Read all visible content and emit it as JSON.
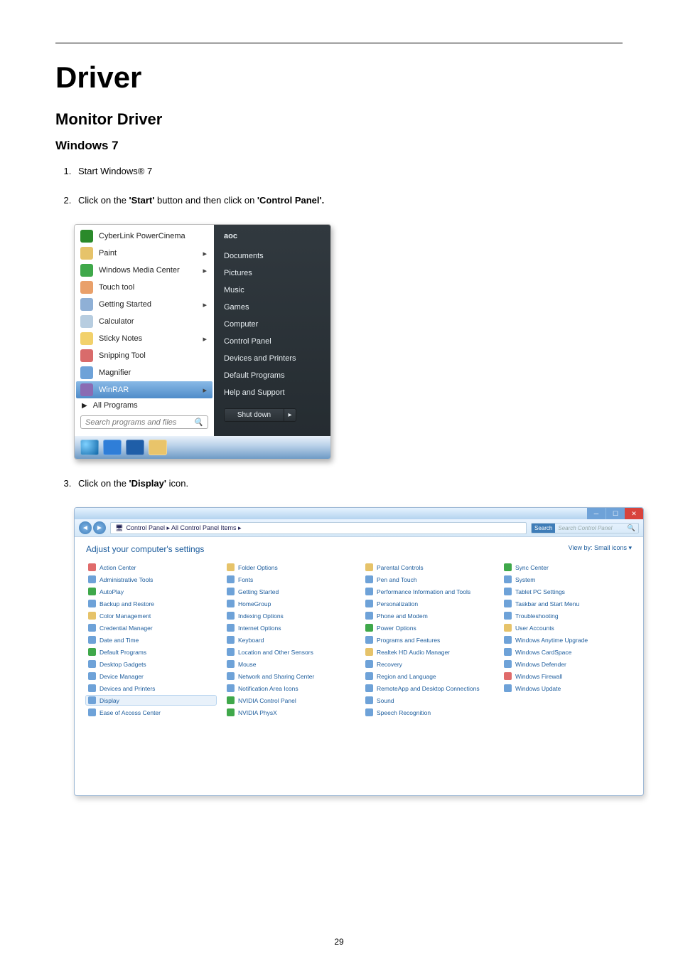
{
  "page_number": "29",
  "title": "Driver",
  "section": "Monitor Driver",
  "subsection": "Windows 7",
  "steps": [
    {
      "n": "1.",
      "plain": "Start Windows® 7"
    },
    {
      "n": "2.",
      "pre": "Click on the ",
      "b1": "'Start'",
      "mid": " button and then click on ",
      "b2": "'Control Panel'."
    },
    {
      "n": "3.",
      "pre": "Click on the ",
      "b1": "'Display'",
      "post": " icon."
    }
  ],
  "start_menu": {
    "left": [
      {
        "label": "CyberLink PowerCinema",
        "icon_color": "#2a8a2a",
        "arrow": false,
        "icon_name": "media-icon"
      },
      {
        "label": "Paint",
        "icon_color": "#e6c36a",
        "arrow": true,
        "icon_name": "paint-icon"
      },
      {
        "label": "Windows Media Center",
        "icon_color": "#3fa84a",
        "arrow": true,
        "icon_name": "media-center-icon"
      },
      {
        "label": "Touch tool",
        "icon_color": "#e9a06a",
        "arrow": false,
        "icon_name": "touch-icon"
      },
      {
        "label": "Getting Started",
        "icon_color": "#8fb0d6",
        "arrow": true,
        "icon_name": "getting-started-icon"
      },
      {
        "label": "Calculator",
        "icon_color": "#b7cde0",
        "arrow": false,
        "icon_name": "calculator-icon"
      },
      {
        "label": "Sticky Notes",
        "icon_color": "#f2d16b",
        "arrow": true,
        "icon_name": "sticky-notes-icon"
      },
      {
        "label": "Snipping Tool",
        "icon_color": "#d96b6b",
        "arrow": false,
        "icon_name": "snipping-icon"
      },
      {
        "label": "Magnifier",
        "icon_color": "#6ea2d8",
        "arrow": false,
        "icon_name": "magnifier-icon"
      },
      {
        "label": "WinRAR",
        "icon_color": "#8a6bb3",
        "arrow": true,
        "icon_name": "winrar-icon",
        "highlight": true
      }
    ],
    "all_programs": "All Programs",
    "search_placeholder": "Search programs and files",
    "right_user": "aoc",
    "right": [
      "Documents",
      "Pictures",
      "Music",
      "Games",
      "Computer",
      "Control Panel",
      "Devices and Printers",
      "Default Programs",
      "Help and Support"
    ],
    "shutdown": "Shut down"
  },
  "control_panel": {
    "breadcrumb": "Control Panel ▸ All Control Panel Items ▸",
    "search_label": "Search",
    "search_placeholder": "Search Control Panel",
    "heading": "Adjust your computer's settings",
    "view_by": "View by:  Small icons ▾",
    "items": [
      {
        "label": "Action Center",
        "c": "#e06b6b"
      },
      {
        "label": "Administrative Tools",
        "c": "#6ea2d8"
      },
      {
        "label": "AutoPlay",
        "c": "#3fa84a"
      },
      {
        "label": "Backup and Restore",
        "c": "#6ea2d8"
      },
      {
        "label": "Color Management",
        "c": "#e6c36a"
      },
      {
        "label": "Credential Manager",
        "c": "#6ea2d8"
      },
      {
        "label": "Date and Time",
        "c": "#6ea2d8"
      },
      {
        "label": "Default Programs",
        "c": "#3fa84a"
      },
      {
        "label": "Desktop Gadgets",
        "c": "#6ea2d8"
      },
      {
        "label": "Device Manager",
        "c": "#6ea2d8"
      },
      {
        "label": "Devices and Printers",
        "c": "#6ea2d8"
      },
      {
        "label": "Display",
        "c": "#6ea2d8",
        "selected": true
      },
      {
        "label": "Ease of Access Center",
        "c": "#6ea2d8"
      },
      {
        "label": "Folder Options",
        "c": "#e6c36a"
      },
      {
        "label": "Fonts",
        "c": "#6ea2d8"
      },
      {
        "label": "Getting Started",
        "c": "#6ea2d8"
      },
      {
        "label": "HomeGroup",
        "c": "#6ea2d8"
      },
      {
        "label": "Indexing Options",
        "c": "#6ea2d8"
      },
      {
        "label": "Internet Options",
        "c": "#6ea2d8"
      },
      {
        "label": "Keyboard",
        "c": "#6ea2d8"
      },
      {
        "label": "Location and Other Sensors",
        "c": "#6ea2d8"
      },
      {
        "label": "Mouse",
        "c": "#6ea2d8"
      },
      {
        "label": "Network and Sharing Center",
        "c": "#6ea2d8"
      },
      {
        "label": "Notification Area Icons",
        "c": "#6ea2d8"
      },
      {
        "label": "NVIDIA Control Panel",
        "c": "#3fa84a"
      },
      {
        "label": "NVIDIA PhysX",
        "c": "#3fa84a"
      },
      {
        "label": "Parental Controls",
        "c": "#e6c36a"
      },
      {
        "label": "Pen and Touch",
        "c": "#6ea2d8"
      },
      {
        "label": "Performance Information and Tools",
        "c": "#6ea2d8"
      },
      {
        "label": "Personalization",
        "c": "#6ea2d8"
      },
      {
        "label": "Phone and Modem",
        "c": "#6ea2d8"
      },
      {
        "label": "Power Options",
        "c": "#3fa84a"
      },
      {
        "label": "Programs and Features",
        "c": "#6ea2d8"
      },
      {
        "label": "Realtek HD Audio Manager",
        "c": "#e6c36a"
      },
      {
        "label": "Recovery",
        "c": "#6ea2d8"
      },
      {
        "label": "Region and Language",
        "c": "#6ea2d8"
      },
      {
        "label": "RemoteApp and Desktop Connections",
        "c": "#6ea2d8"
      },
      {
        "label": "Sound",
        "c": "#6ea2d8"
      },
      {
        "label": "Speech Recognition",
        "c": "#6ea2d8"
      },
      {
        "label": "Sync Center",
        "c": "#3fa84a"
      },
      {
        "label": "System",
        "c": "#6ea2d8"
      },
      {
        "label": "Tablet PC Settings",
        "c": "#6ea2d8"
      },
      {
        "label": "Taskbar and Start Menu",
        "c": "#6ea2d8"
      },
      {
        "label": "Troubleshooting",
        "c": "#6ea2d8"
      },
      {
        "label": "User Accounts",
        "c": "#e6c36a"
      },
      {
        "label": "Windows Anytime Upgrade",
        "c": "#6ea2d8"
      },
      {
        "label": "Windows CardSpace",
        "c": "#6ea2d8"
      },
      {
        "label": "Windows Defender",
        "c": "#6ea2d8"
      },
      {
        "label": "Windows Firewall",
        "c": "#e06b6b"
      },
      {
        "label": "Windows Update",
        "c": "#6ea2d8"
      }
    ]
  }
}
